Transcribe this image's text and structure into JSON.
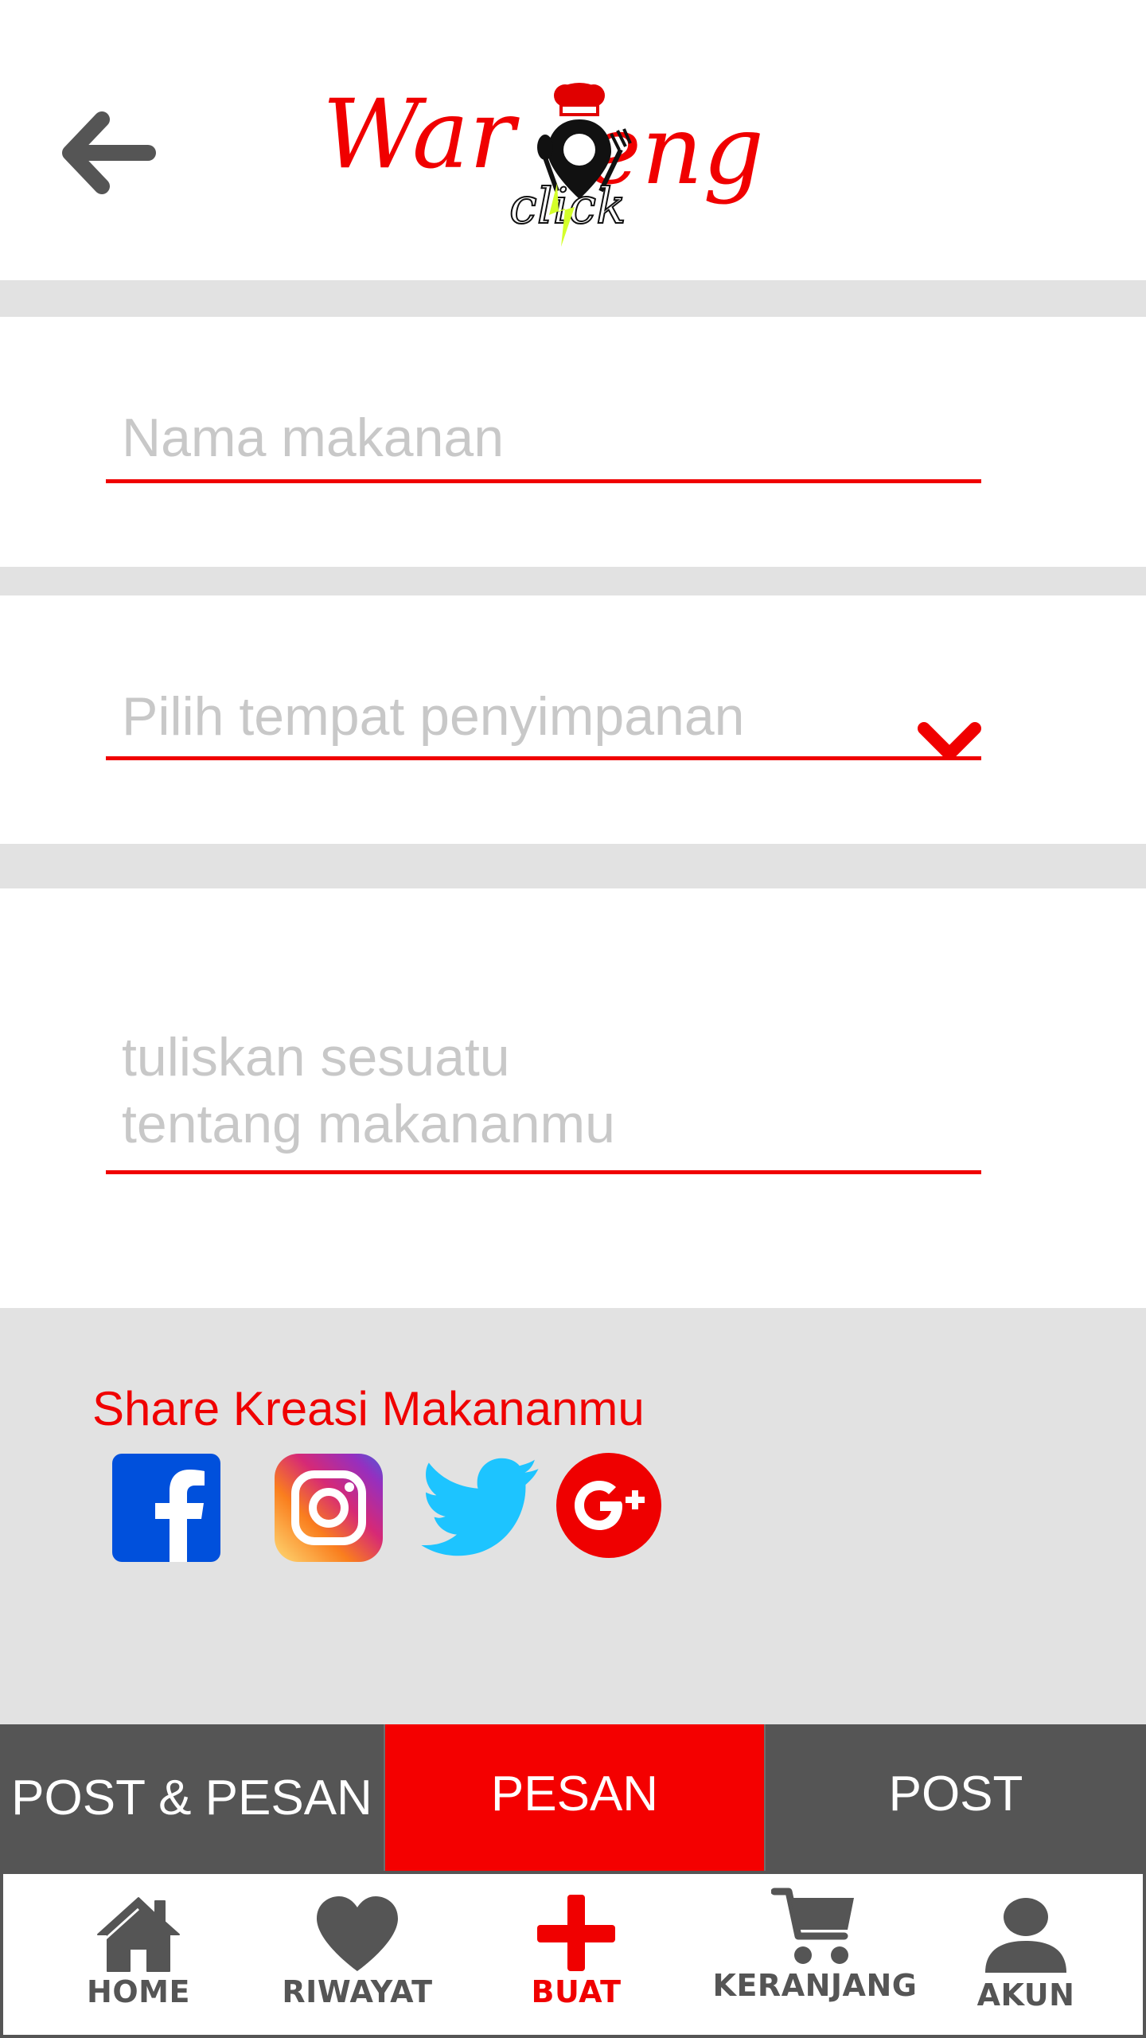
{
  "header": {
    "back_icon": "arrow-left-icon",
    "logo_text_main": "Wareng",
    "logo_text_sub": "click"
  },
  "form": {
    "food_name_placeholder": "Nama makanan",
    "storage_placeholder": "Pilih tempat penyimpanan",
    "description_placeholder": "tuliskan sesuatu\ntentang makananmu"
  },
  "share": {
    "title": "Share Kreasi Makananmu",
    "icons": [
      "facebook-icon",
      "instagram-icon",
      "twitter-icon",
      "google-plus-icon"
    ]
  },
  "tabs": {
    "post_pesan": "POST & PESAN",
    "pesan": "PESAN",
    "post": "POST"
  },
  "nav": {
    "home": "HOME",
    "riwayat": "RIWAYAT",
    "buat": "BUAT",
    "keranjang": "KERANJANG",
    "akun": "AKUN"
  },
  "colors": {
    "accent": "#f00000",
    "dark_gray": "#555555",
    "light_gray": "#e2e2e2",
    "placeholder": "#c8c8c8"
  }
}
